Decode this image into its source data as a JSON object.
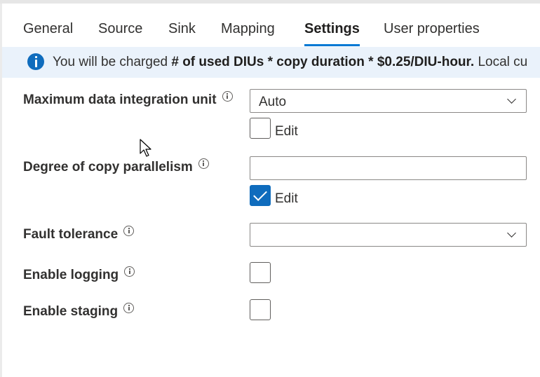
{
  "tabs": [
    {
      "label": "General"
    },
    {
      "label": "Source"
    },
    {
      "label": "Sink"
    },
    {
      "label": "Mapping"
    },
    {
      "label": "Settings",
      "active": true
    },
    {
      "label": "User properties"
    }
  ],
  "banner": {
    "prefix": "You will be charged ",
    "bold": "# of used DIUs * copy duration * $0.25/DIU-hour.",
    "suffix": " Local cu"
  },
  "settings": {
    "max_diu": {
      "label": "Maximum data integration unit",
      "value": "Auto",
      "edit_label": "Edit",
      "edit_checked": false
    },
    "parallelism": {
      "label": "Degree of copy parallelism",
      "value": "",
      "edit_label": "Edit",
      "edit_checked": true
    },
    "fault_tolerance": {
      "label": "Fault tolerance",
      "value": ""
    },
    "logging": {
      "label": "Enable logging",
      "checked": false
    },
    "staging": {
      "label": "Enable staging",
      "checked": false
    }
  },
  "colors": {
    "accent": "#0078d4",
    "banner_bg": "#eaf2fb",
    "info_icon": "#0f6cbd"
  }
}
